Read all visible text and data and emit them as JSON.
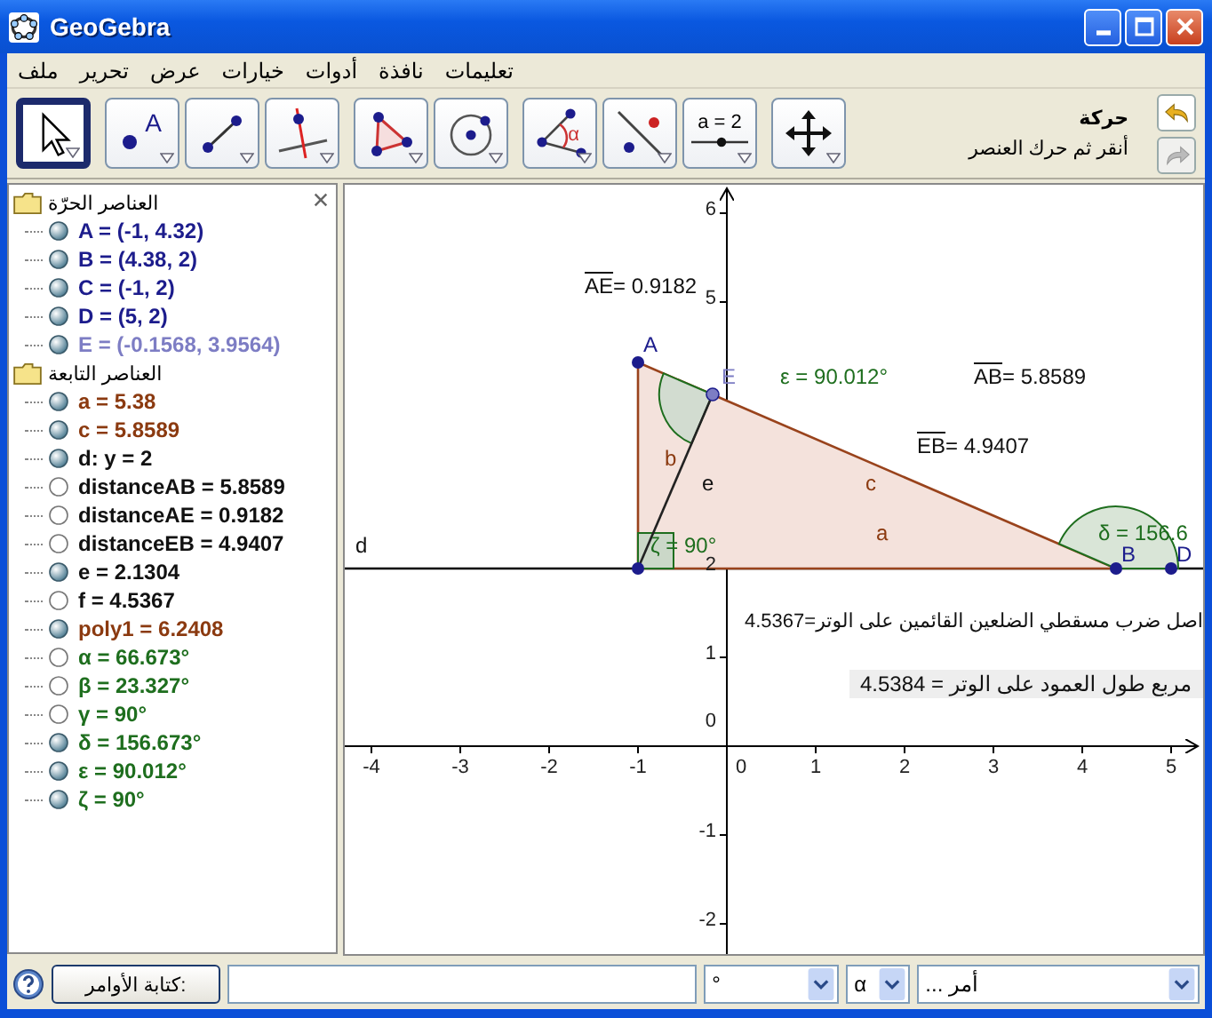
{
  "window": {
    "title": "GeoGebra"
  },
  "menu": [
    "تعليمات",
    "نافذة",
    "أدوات",
    "خيارات",
    "عرض",
    "تحرير",
    "ملف"
  ],
  "toolbar": {
    "groups": [
      [
        {
          "kind": "move-view",
          "selected": false
        }
      ],
      [
        {
          "kind": "slider",
          "label": "a = 2",
          "selected": false
        },
        {
          "kind": "reflect",
          "selected": false
        },
        {
          "kind": "angle",
          "label": "α",
          "selected": false
        }
      ],
      [
        {
          "kind": "circle",
          "selected": false
        },
        {
          "kind": "polygon",
          "selected": false
        }
      ],
      [
        {
          "kind": "perpendicular",
          "selected": false
        },
        {
          "kind": "segment",
          "selected": false
        },
        {
          "kind": "point",
          "label": "A",
          "selected": false
        }
      ],
      [
        {
          "kind": "move",
          "selected": true
        }
      ]
    ],
    "tool_name": "حركة",
    "tool_help": "أنقر ثم حرك العنصر",
    "undo": {
      "disabled": false
    },
    "redo": {
      "disabled": true
    }
  },
  "algebra": {
    "groups": [
      {
        "title": "العناصر الحرّة",
        "items": [
          {
            "text": "A = (-1, 4.32)",
            "color": "#1c1c8c",
            "visible": true
          },
          {
            "text": "B = (4.38, 2)",
            "color": "#1c1c8c",
            "visible": true
          },
          {
            "text": "C = (-1, 2)",
            "color": "#1c1c8c",
            "visible": true
          },
          {
            "text": "D = (5, 2)",
            "color": "#1c1c8c",
            "visible": true
          },
          {
            "text": "E = (-0.1568, 3.9564)",
            "color": "#7d7dc4",
            "visible": true
          }
        ]
      },
      {
        "title": "العناصر التابعة",
        "items": [
          {
            "text": "a = 5.38",
            "color": "#8b3a10",
            "visible": true
          },
          {
            "text": "c = 5.8589",
            "color": "#8b3a10",
            "visible": true
          },
          {
            "text": "d: y = 2",
            "color": "#111111",
            "visible": true
          },
          {
            "text": "distanceAB = 5.8589",
            "color": "#111111",
            "visible": false
          },
          {
            "text": "distanceAE = 0.9182",
            "color": "#111111",
            "visible": false
          },
          {
            "text": "distanceEB = 4.9407",
            "color": "#111111",
            "visible": false
          },
          {
            "text": "e = 2.1304",
            "color": "#111111",
            "visible": true
          },
          {
            "text": "f = 4.5367",
            "color": "#111111",
            "visible": false
          },
          {
            "text": "poly1 = 6.2408",
            "color": "#8b3a10",
            "visible": true
          },
          {
            "text": "α = 66.673°",
            "color": "#1e6e1e",
            "visible": false
          },
          {
            "text": "β = 23.327°",
            "color": "#1e6e1e",
            "visible": false
          },
          {
            "text": "γ = 90°",
            "color": "#1e6e1e",
            "visible": false
          },
          {
            "text": "δ = 156.673°",
            "color": "#1e6e1e",
            "visible": true
          },
          {
            "text": "ε = 90.012°",
            "color": "#1e6e1e",
            "visible": true
          },
          {
            "text": "ζ = 90°",
            "color": "#1e6e1e",
            "visible": true
          }
        ]
      }
    ]
  },
  "graphics": {
    "x_ticks": [
      "5",
      "4",
      "3",
      "2",
      "1",
      "0",
      "-1",
      "-2",
      "-3",
      "-4"
    ],
    "y_ticks": [
      "6",
      "5",
      "2",
      "1",
      "0",
      "-1",
      "-2"
    ],
    "labels": [
      {
        "kind": "measure",
        "segment": "AE",
        "text": "= 0.9182",
        "color": "#111111"
      },
      {
        "kind": "name",
        "text": "A",
        "color": "#1c1c8c"
      },
      {
        "kind": "measure",
        "segment": "AB",
        "text": "= 5.8589",
        "color": "#111111"
      },
      {
        "kind": "name",
        "text": "ε = 90.012°",
        "color": "#1e6e1e"
      },
      {
        "kind": "name",
        "text": "E",
        "color": "#7d7dc4"
      },
      {
        "kind": "measure",
        "segment": "EB",
        "text": "= 4.9407",
        "color": "#111111"
      },
      {
        "kind": "name",
        "text": "c",
        "color": "#8b3a10"
      },
      {
        "kind": "name",
        "text": "e",
        "color": "#111111"
      },
      {
        "kind": "name",
        "text": "b",
        "color": "#8b3a10"
      },
      {
        "kind": "name",
        "text": "δ = 156.6",
        "color": "#1e6e1e"
      },
      {
        "kind": "name",
        "text": "a",
        "color": "#8b3a10"
      },
      {
        "kind": "name",
        "text": "D",
        "color": "#1c1c8c"
      },
      {
        "kind": "name",
        "text": "B",
        "color": "#1c1c8c"
      },
      {
        "kind": "name",
        "text": "ζ = 90°",
        "color": "#1e6e1e"
      },
      {
        "kind": "name",
        "text": "d",
        "color": "#111111"
      },
      {
        "kind": "caption",
        "text": "اصل ضرب مسقطي الضلعين القائمين على الوتر=4.5367",
        "color": "#111111"
      },
      {
        "kind": "boxed",
        "text": "مربع طول العمود على الوتر = 4.5384",
        "color": "#111111"
      }
    ]
  },
  "input_bar": {
    "command_button": "كتابة الأوامر:",
    "dropdowns": [
      "أمر ...",
      "α",
      "°"
    ]
  }
}
